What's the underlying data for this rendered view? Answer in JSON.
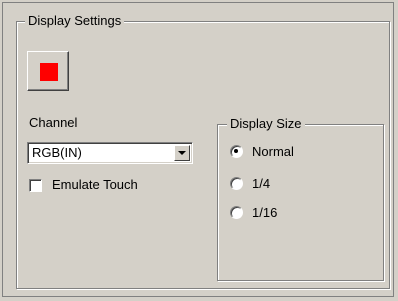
{
  "display_settings": {
    "title": "Display Settings",
    "color_button": {
      "swatch_color": "#ff0000"
    },
    "channel": {
      "label": "Channel",
      "selected": "RGB(IN)"
    },
    "emulate_touch": {
      "label": "Emulate Touch",
      "checked": false
    },
    "display_size": {
      "title": "Display Size",
      "options": [
        {
          "label": "Normal",
          "selected": true
        },
        {
          "label": "1/4",
          "selected": false
        },
        {
          "label": "1/16",
          "selected": false
        }
      ]
    }
  }
}
